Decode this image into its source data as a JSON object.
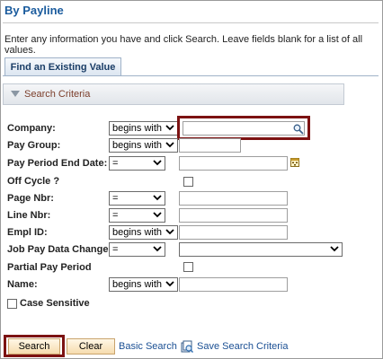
{
  "page": {
    "title": "By Payline",
    "instructions": "Enter any information you have and click Search. Leave fields blank for a list of all values."
  },
  "tabs": [
    {
      "label": "Find an Existing Value"
    }
  ],
  "section": {
    "label": "Search Criteria"
  },
  "fields": {
    "company": {
      "label": "Company:",
      "operator": "begins with",
      "value": ""
    },
    "pay_group": {
      "label": "Pay Group:",
      "operator": "begins with",
      "value": ""
    },
    "pay_period_end": {
      "label": "Pay Period End Date:",
      "operator": "=",
      "value": ""
    },
    "off_cycle": {
      "label": "Off Cycle ?",
      "checked": false
    },
    "page_nbr": {
      "label": "Page Nbr:",
      "operator": "=",
      "value": ""
    },
    "line_nbr": {
      "label": "Line Nbr:",
      "operator": "=",
      "value": ""
    },
    "empl_id": {
      "label": "Empl ID:",
      "operator": "begins with",
      "value": ""
    },
    "job_pay_data_change": {
      "label": "Job Pay Data Change:",
      "operator": "=",
      "value": ""
    },
    "partial_pay_period": {
      "label": "Partial Pay Period",
      "checked": false
    },
    "name": {
      "label": "Name:",
      "operator": "begins with",
      "value": ""
    }
  },
  "case_sensitive": {
    "label": "Case Sensitive",
    "checked": false
  },
  "buttons": {
    "search": "Search",
    "clear": "Clear",
    "basic_search": "Basic Search",
    "save_search": "Save Search Criteria"
  },
  "colors": {
    "title": "#1a5b9d",
    "section_label": "#7b3d2a",
    "highlight": "#7c1212",
    "link": "#1a4f93",
    "button_bg": "#f6dcae"
  },
  "icons": [
    "lookup-icon",
    "calendar-icon",
    "chevron-down-icon",
    "save-search-icon",
    "collapse-triangle-icon"
  ]
}
